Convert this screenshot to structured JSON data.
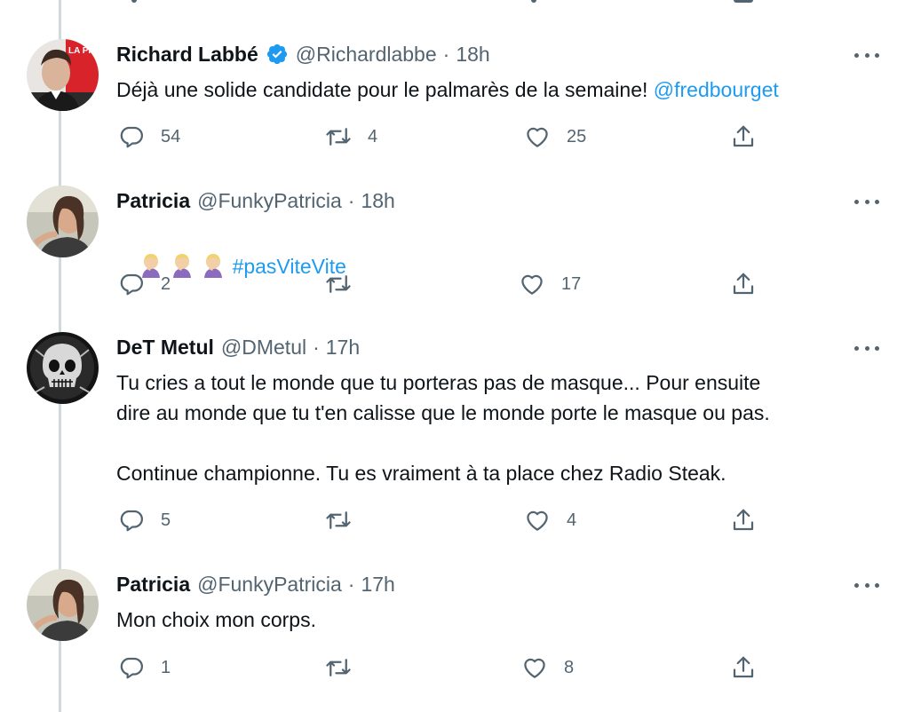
{
  "tweets": [
    {
      "name": "Richard Labbé",
      "verified": true,
      "handle": "@Richardlabbe",
      "separator": "·",
      "time": "18h",
      "text": "Déjà une solide candidate pour le palmarès de la semaine! ",
      "link": "@fredbourget",
      "avatar_text": "LA PRESSE",
      "replies": "54",
      "retweets": "4",
      "likes": "25"
    },
    {
      "name": "Patricia",
      "handle": "@FunkyPatricia",
      "separator": "·",
      "time": "18h",
      "hashtag": "#pasViteVite",
      "emoji": "facepalm-emoji",
      "replies": "2",
      "retweets": "",
      "likes": "17"
    },
    {
      "name": "DeT Metul",
      "handle": "@DMetul",
      "separator": "·",
      "time": "17h",
      "text": "Tu cries a tout le monde que tu porteras pas de masque... Pour ensuite\ndire au monde que tu t'en calisse que le monde porte le masque ou pas.\n\nContinue championne. Tu es vraiment à ta place chez Radio Steak.",
      "replies": "5",
      "retweets": "",
      "likes": "4"
    },
    {
      "name": "Patricia",
      "handle": "@FunkyPatricia",
      "separator": "·",
      "time": "17h",
      "text": "Mon choix mon corps.",
      "replies": "1",
      "retweets": "",
      "likes": "8"
    }
  ],
  "colors": {
    "link": "#1d9bf0",
    "secondary_text": "#536471",
    "thread_line": "#cfd9de",
    "verified": "#1d9bf0"
  },
  "icons": {
    "reply": "reply-icon",
    "retweet": "retweet-icon",
    "like": "heart-icon",
    "share": "share-icon",
    "more": "more-icon"
  }
}
